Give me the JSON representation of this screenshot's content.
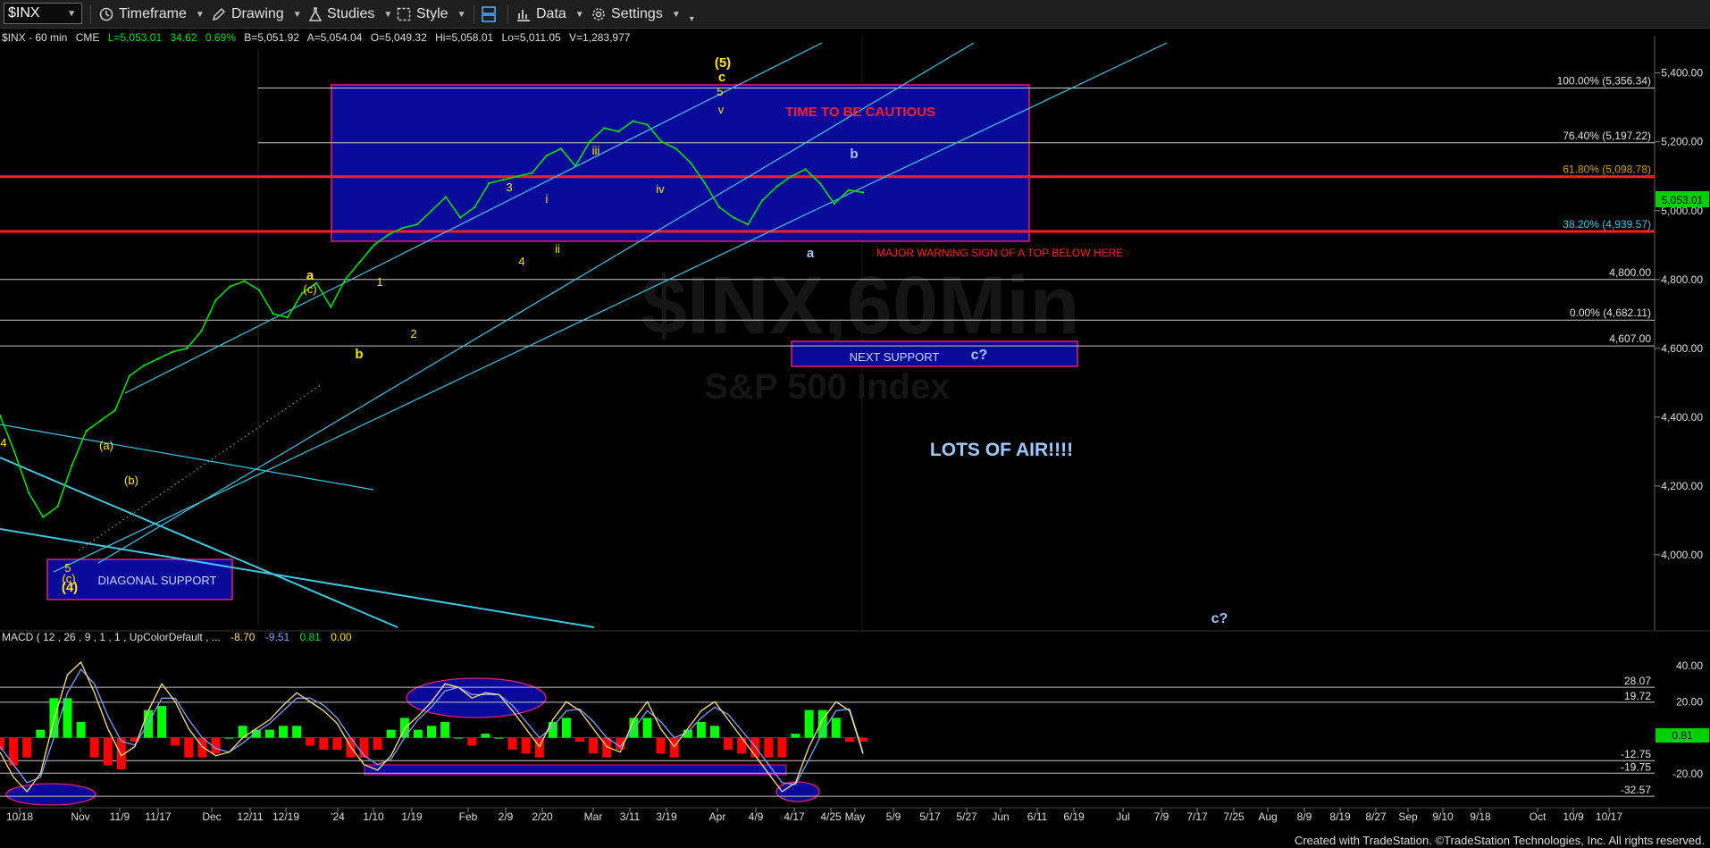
{
  "toolbar": {
    "symbol": "$INX",
    "timeframe": "Timeframe",
    "drawing": "Drawing",
    "studies": "Studies",
    "style": "Style",
    "data": "Data",
    "settings": "Settings"
  },
  "header": {
    "symbol_desc": "$INX - 60 min",
    "exchange": "CME",
    "last": "L=5,053.01",
    "change": "34.62",
    "change_pct": "0.69%",
    "bid": "B=5,051.92",
    "ask": "A=5,054.04",
    "open": "O=5,049.32",
    "high": "Hi=5,058.01",
    "low": "Lo=5,011.05",
    "volume": "V=1,283,977"
  },
  "watermark": {
    "line1": "$INX,60Min",
    "line2": "S&P 500 Index"
  },
  "footer": "Created with TradeStation. ©TradeStation Technologies, Inc. All rights reserved.",
  "colors": {
    "background": "#000000",
    "price": "#00e000",
    "channel": "#3ec6e0",
    "fib_line": "#c8c8c8",
    "red_line": "#ff2020",
    "box_fill": "#0a0a9a",
    "box_border": "#e0206a",
    "wave_label": "#ffe600",
    "macd_hist_up": "#00ff00",
    "macd_hist_down": "#ff0000",
    "macd_line": "#ffe080",
    "signal_line": "#7aa0ff"
  },
  "chart_data": [
    {
      "type": "line",
      "title": "$INX,60Min",
      "subtitle": "S&P 500 Index",
      "ylim": [
        3870,
        5420
      ],
      "y_ticks": [
        "5,400.00",
        "5,200.00",
        "5,000.00",
        "4,800.00",
        "4,600.00",
        "4,400.00",
        "4,200.00",
        "4,000.00"
      ],
      "x_ticks": [
        "10/18",
        "Nov",
        "11/9",
        "11/17",
        "Dec",
        "12/11",
        "12/19",
        "'24",
        "1/10",
        "1/19",
        "Feb",
        "2/9",
        "2/20",
        "Mar",
        "3/11",
        "3/19",
        "Apr",
        "4/9",
        "4/17",
        "4/25",
        "May",
        "5/9",
        "5/17",
        "5/27",
        "Jun",
        "6/11",
        "6/19",
        "Jul",
        "7/9",
        "7/17",
        "7/25",
        "Aug",
        "8/9",
        "8/19",
        "8/27",
        "Sep",
        "9/10",
        "9/18",
        "Oct",
        "10/9",
        "10/17"
      ],
      "series": [
        {
          "values": [
            4405,
            4300,
            4180,
            4110,
            4140,
            4260,
            4360,
            4390,
            4420,
            4520,
            4550,
            4570,
            4590,
            4600,
            4650,
            4740,
            4780,
            4795,
            4770,
            4700,
            4690,
            4760,
            4790,
            4720,
            4800,
            4850,
            4900,
            4930,
            4950,
            4960,
            5000,
            5040,
            4980,
            5010,
            5080,
            5090,
            5100,
            5110,
            5160,
            5180,
            5130,
            5200,
            5240,
            5230,
            5260,
            5250,
            5200,
            5180,
            5140,
            5080,
            5010,
            4980,
            4960,
            5030,
            5070,
            5100,
            5120,
            5080,
            5020,
            5060,
            5053
          ]
        }
      ],
      "fib_levels": [
        {
          "pct": "100.00%",
          "price": 5356.34,
          "label": "100.00% (5,356.34)"
        },
        {
          "pct": "76.40%",
          "price": 5197.22,
          "label": "76.40% (5,197.22)"
        },
        {
          "pct": "61.80%",
          "price": 5098.78,
          "label": "61.80% (5,098.78)"
        },
        {
          "pct": "38.20%",
          "price": 4939.57,
          "label": "38.20% (4,939.57)"
        },
        {
          "price": 4800,
          "label": "4,800.00"
        },
        {
          "pct": "0.00%",
          "price": 4682.11,
          "label": "0.00% (4,682.11)"
        },
        {
          "price": 4607,
          "label": "4,607.00"
        }
      ],
      "last_price_tag": "5,053.01",
      "annotations": [
        {
          "text": "TIME TO BE CAUTIOUS",
          "color": "#ff2020"
        },
        {
          "text": "MAJOR WARNING SIGN OF A TOP BELOW HERE",
          "color": "#ff2020"
        },
        {
          "text": "NEXT SUPPORT",
          "color": "#c0d8ff"
        },
        {
          "text": "DIAGONAL SUPPORT",
          "color": "#c0d8ff"
        },
        {
          "text": "LOTS OF AIR!!!!",
          "color": "#a0c8ff"
        },
        {
          "text": "c?",
          "color": "#a0c8ff"
        },
        {
          "text": "c?",
          "color": "#a0c8ff"
        }
      ],
      "wave_labels": [
        "(5)",
        "c",
        "5",
        "v",
        "iii",
        "iv",
        "3",
        "i",
        "ii",
        "4",
        "a",
        "(c)",
        "1",
        "2",
        "b",
        "(a)",
        "(b)",
        "5",
        "(c)",
        "(4)",
        "4",
        "b",
        "a"
      ]
    },
    {
      "type": "bar",
      "title": "MACD ( 12 , 26 , 9 , 1 , 1 , UpColorDefault , ...",
      "readouts": [
        "-8.70",
        "-9.51",
        "0.81",
        "0.00"
      ],
      "ylim": [
        -36,
        46
      ],
      "y_ticks": [
        "40.00",
        "20.00",
        "-20.00"
      ],
      "levels": [
        "28.07",
        "19.72",
        "-12.75",
        "-19.75",
        "-32.57"
      ],
      "last_value_tag": "0.81",
      "series": [
        {
          "name": "MACD",
          "values": [
            -8,
            -22,
            -30,
            -20,
            10,
            35,
            42,
            25,
            5,
            -10,
            -5,
            15,
            30,
            20,
            5,
            -5,
            -10,
            -8,
            0,
            5,
            10,
            18,
            25,
            20,
            15,
            8,
            -5,
            -15,
            -18,
            -10,
            5,
            12,
            20,
            30,
            28,
            22,
            25,
            24,
            15,
            5,
            -5,
            10,
            20,
            15,
            5,
            -5,
            -8,
            10,
            20,
            5,
            -5,
            5,
            15,
            20,
            10,
            0,
            -10,
            -20,
            -30,
            -25,
            -5,
            10,
            20,
            15,
            -9
          ]
        },
        {
          "name": "Signal",
          "values": [
            -5,
            -15,
            -25,
            -22,
            0,
            25,
            38,
            30,
            12,
            -2,
            -4,
            8,
            22,
            22,
            10,
            0,
            -6,
            -8,
            -3,
            3,
            8,
            15,
            22,
            22,
            18,
            11,
            0,
            -10,
            -15,
            -12,
            0,
            10,
            17,
            26,
            28,
            24,
            24,
            24,
            18,
            9,
            0,
            6,
            15,
            16,
            9,
            0,
            -5,
            5,
            15,
            9,
            0,
            3,
            11,
            17,
            13,
            4,
            -5,
            -15,
            -25,
            -26,
            -12,
            3,
            15,
            16,
            -8
          ]
        }
      ]
    }
  ]
}
